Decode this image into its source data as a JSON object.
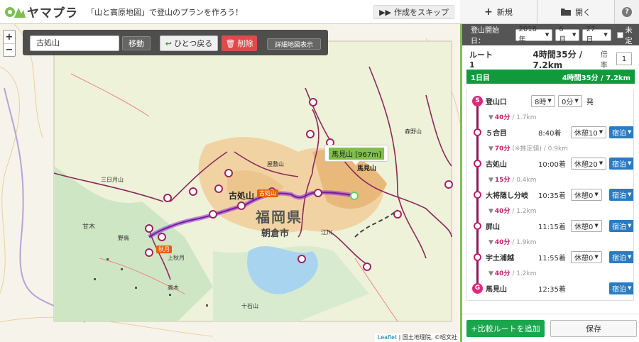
{
  "header": {
    "brand": "ヤマプラ",
    "tagline": "「山と高原地図」で登山のプランを作ろう！",
    "skip_label": "作成をスキップ"
  },
  "topbar": {
    "new_label": "新規",
    "open_label": "開く",
    "help": "?"
  },
  "map": {
    "search_value": "古処山",
    "move_label": "移動",
    "undo_label": "ひとつ戻る",
    "delete_label": "削除",
    "detail_label": "詳細地図表示",
    "popup": "馬見山 [967m]",
    "labels": {
      "prefecture": "福岡県",
      "city": "朝倉市",
      "kosho": "古処山",
      "kosho_badge": "古処山",
      "amagi": "甘木",
      "akizuki": "秋月",
      "umami": "馬見山",
      "yashiki": "屋敷山",
      "kaminoue": "上秋月",
      "nogata": "野鳥",
      "morinoyama": "森野山",
      "takaki": "高木",
      "e_river": "江川",
      "juukusan": "十石山",
      "mikkabi": "三日月山"
    },
    "attribution": {
      "leaflet": "Leaflet",
      "rest": " | 国土地理院, ©昭文社"
    }
  },
  "panel": {
    "date_label": "登山開始日：",
    "year": "2018年",
    "month": "6月",
    "day": "27日",
    "undecided": "未定",
    "route_name": "ルート1",
    "route_total": "4時間35分 / 7.2km",
    "rate_label": "倍率",
    "rate_value": "1",
    "day_label": "1日目",
    "day_total": "4時間35分 / 7.2km",
    "start": {
      "name": "登山口",
      "hour": "8時",
      "minute": "0分",
      "suffix": "発"
    },
    "stops": [
      {
        "name": "５合目",
        "time": "8:40着",
        "rest": "休憩10"
      },
      {
        "name": "古処山",
        "time": "10:00着",
        "rest": "休憩20"
      },
      {
        "name": "大将隠し分岐",
        "time": "10:35着",
        "rest": "休憩0"
      },
      {
        "name": "屏山",
        "time": "11:15着",
        "rest": "休憩0"
      },
      {
        "name": "宇土浦越",
        "time": "11:55着",
        "rest": "休憩0"
      }
    ],
    "goal": {
      "name": "馬見山",
      "time": "12:35着"
    },
    "legs": [
      {
        "time": "40分",
        "dist": " / 1.7km"
      },
      {
        "time": "70分",
        "dist": " (※推定値) / 0.9km"
      },
      {
        "time": "15分",
        "dist": " / 0.4km"
      },
      {
        "time": "40分",
        "dist": " / 1.2km"
      },
      {
        "time": "40分",
        "dist": " / 1.9km"
      },
      {
        "time": "40分",
        "dist": " / 1.2km"
      }
    ],
    "stay_label": "宿泊",
    "start_badge": "S",
    "goal_badge": "G",
    "add_route_label": "+比較ルートを追加",
    "save_label": "保存"
  }
}
